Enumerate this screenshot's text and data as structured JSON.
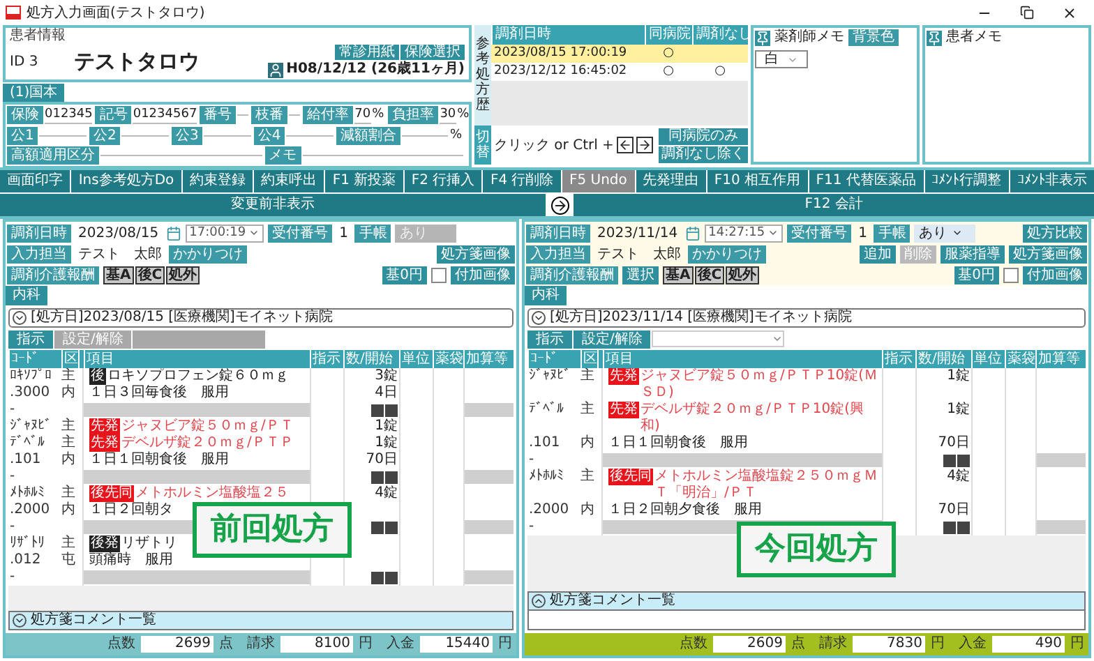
{
  "window": {
    "title": "処方入力画面(テストタロウ)"
  },
  "patient": {
    "section": "患者情報",
    "id": "ID 3",
    "name": "テストタロウ",
    "buttons": [
      "常診用紙",
      "保険選択"
    ],
    "birth": "H08/12/12 (26歳11ヶ月)"
  },
  "insurance": {
    "tab": "(1)国本",
    "rows": [
      [
        {
          "label": "保険",
          "value": "012345"
        },
        {
          "label": "記号",
          "value": "01234567"
        },
        {
          "label": "番号"
        },
        {
          "label": "枝番"
        },
        {
          "label": "給付率",
          "value": "70",
          "unit": "%"
        },
        {
          "label": "負担率",
          "value": "30",
          "unit": "%"
        }
      ],
      [
        {
          "label": "公1"
        },
        {
          "label": "公2"
        },
        {
          "label": "公3"
        },
        {
          "label": "公4"
        },
        {
          "label": "減額割合",
          "unit": "%"
        }
      ],
      [
        {
          "label": "高額適用区分"
        },
        {
          "label": "メモ"
        }
      ]
    ]
  },
  "history": {
    "label": "参考処方歴",
    "columns": [
      "調剤日時",
      "同病院",
      "調剤なし"
    ],
    "rows": [
      {
        "date": "2023/08/15 17:00:19",
        "same_hospital": "○",
        "selected": true
      },
      {
        "date": "2023/12/12 16:45:02",
        "same_hospital": "○",
        "no_dispense": "○",
        "selected": false
      }
    ],
    "switch_label": "切替",
    "hint": "クリック or Ctrl +",
    "buttons": [
      "同病院のみ",
      "調剤なし除く"
    ]
  },
  "memos": [
    {
      "title": "薬剤師メモ",
      "color_label": "背景色",
      "color_value": "白"
    },
    {
      "title": "患者メモ"
    }
  ],
  "toolbar": [
    {
      "kind": "button",
      "label": "画面印字",
      "disabled": false
    },
    {
      "kind": "button",
      "label": "Ins参考処方Do",
      "disabled": false
    },
    {
      "kind": "button",
      "label": "約束登録",
      "disabled": false
    },
    {
      "kind": "button",
      "label": "約束呼出",
      "disabled": false
    },
    {
      "kind": "button",
      "label": "F1 新投薬",
      "disabled": false
    },
    {
      "kind": "button",
      "label": "F2 行挿入",
      "disabled": false
    },
    {
      "kind": "button",
      "label": "F4 行削除",
      "disabled": false
    },
    {
      "kind": "button",
      "label": "F5 Undo",
      "disabled": true
    },
    {
      "kind": "button",
      "label": "先発理由",
      "disabled": false
    },
    {
      "kind": "button",
      "label": "F10 相互作用",
      "disabled": false
    },
    {
      "kind": "button",
      "label": "F11 代替医薬品",
      "disabled": false
    },
    {
      "kind": "button",
      "label": "ｺﾒﾝﾄ行調整",
      "disabled": false
    },
    {
      "kind": "button",
      "label": "ｺﾒﾝﾄ非表示",
      "disabled": false
    },
    {
      "kind": "button",
      "label": "変更前非表示",
      "disabled": false
    },
    {
      "kind": "arrow",
      "disabled": false
    },
    {
      "kind": "button",
      "label": "F12 会計",
      "disabled": false
    }
  ],
  "panels": [
    {
      "header": [
        {
          "left": [
            {
              "kind": "chip",
              "text": "調剤日時"
            },
            {
              "kind": "text",
              "text": "2023/08/15"
            },
            {
              "kind": "calendar"
            },
            {
              "kind": "time",
              "text": "17:00:19"
            },
            {
              "kind": "chip",
              "text": "受付番号"
            },
            {
              "kind": "text",
              "text": "1"
            },
            {
              "kind": "chip",
              "text": "手帳"
            },
            {
              "kind": "select",
              "text": "あり",
              "disabled": true
            }
          ]
        },
        {
          "left": [
            {
              "kind": "chip",
              "text": "入力担当"
            },
            {
              "kind": "text",
              "text": "テスト　太郎"
            },
            {
              "kind": "chip",
              "text": "かかりつけ"
            }
          ],
          "right": [
            {
              "kind": "button",
              "text": "処方箋画像",
              "disabled": false
            }
          ]
        },
        {
          "left": [
            {
              "kind": "chip",
              "text": "調剤介護報酬"
            },
            {
              "kind": "codes",
              "codes": [
                "基A",
                "後C",
                "処外"
              ]
            }
          ],
          "right": [
            {
              "kind": "button",
              "text": "基0円",
              "disabled": false
            },
            {
              "kind": "checkbox",
              "checked": false
            },
            {
              "kind": "button",
              "text": "付加画像",
              "disabled": false
            }
          ]
        }
      ],
      "tab": {
        "label": "内科",
        "selected": true
      },
      "rx_bar": {
        "label": "[処方日]2023/08/15 [医療機関]モイネット病院",
        "expanded": true
      },
      "instructions": {
        "buttons": [
          {
            "label": "指示",
            "disabled": false
          },
          {
            "label": "設定/解除",
            "disabled": true
          }
        ],
        "has_select": false
      },
      "columns": [
        "ｺｰﾄﾞ",
        "区",
        "項目",
        "指示",
        "数/開始",
        "単位",
        "薬袋",
        "加算等"
      ],
      "groups": [
        {
          "lines": [
            {
              "kind": "drug",
              "code": "ﾛｷｿﾌﾟﾛ",
              "kubun": "主",
              "badge": {
                "text": "後",
                "color": "#222222"
              },
              "item": "ロキソプロフェン錠６０ｍｇ",
              "brand": false,
              "qty": "3錠"
            },
            {
              "kind": "usage",
              "code": ".3000",
              "kubun": "内",
              "item": "１日３回毎食後　服用",
              "qty": "4日"
            },
            {
              "kind": "footer",
              "code": "-"
            }
          ]
        },
        {
          "lines": [
            {
              "kind": "drug",
              "code": "ｼﾞｬﾇﾋﾞ",
              "kubun": "主",
              "badge": {
                "text": "先発",
                "color": "#e8141b"
              },
              "item": "ジャヌビア錠５０ｍｇ/ＰＴ",
              "brand": true,
              "qty": "1錠"
            },
            {
              "kind": "drug",
              "code": "ﾃﾞﾍﾞﾙ",
              "kubun": "主",
              "badge": {
                "text": "先発",
                "color": "#e8141b"
              },
              "item": "デベルザ錠２０ｍｇ/ＰＴＰ",
              "brand": true,
              "qty": "1錠"
            },
            {
              "kind": "usage",
              "code": ".101",
              "kubun": "内",
              "item": "１日１回朝食後　服用",
              "qty": "70日"
            },
            {
              "kind": "footer",
              "code": "-"
            }
          ]
        },
        {
          "lines": [
            {
              "kind": "drug",
              "code": "ﾒﾄﾎﾙﾐ",
              "kubun": "主",
              "badge": {
                "text": "後先同",
                "color": "#e8141b"
              },
              "item": "メトホルミン塩酸塩２５",
              "brand": true,
              "qty": "4錠"
            },
            {
              "kind": "usage",
              "code": ".2000",
              "kubun": "内",
              "item": "１日２回朝タ"
            },
            {
              "kind": "footer",
              "code": "-"
            }
          ]
        },
        {
          "lines": [
            {
              "kind": "drug",
              "code": "ﾘｻﾞﾄﾘ",
              "kubun": "主",
              "badge": {
                "text": "後発",
                "color": "#222222"
              },
              "item": "リザトリ",
              "brand": false
            },
            {
              "kind": "usage",
              "code": ".012",
              "kubun": "屯",
              "item": "頭痛時　服用"
            },
            {
              "kind": "footer",
              "code": "-"
            }
          ]
        }
      ],
      "stamp": "前回処方",
      "comments": {
        "label": "処方箋コメント一覧",
        "expanded": false
      },
      "totals": {
        "color": "#7cc4c8",
        "items": [
          {
            "label": "点数",
            "value": "2699",
            "unit": "点"
          },
          {
            "label": "請求",
            "value": "8100",
            "unit": "円"
          },
          {
            "label": "入金",
            "value": "15440",
            "unit": "円"
          }
        ]
      }
    },
    {
      "header": [
        {
          "left": [
            {
              "kind": "chip",
              "text": "調剤日時"
            },
            {
              "kind": "text",
              "text": "2023/11/14"
            },
            {
              "kind": "calendar"
            },
            {
              "kind": "time",
              "text": "14:27:15"
            },
            {
              "kind": "chip",
              "text": "受付番号"
            },
            {
              "kind": "text",
              "text": "1"
            },
            {
              "kind": "chip",
              "text": "手帳"
            },
            {
              "kind": "select",
              "text": "あり",
              "disabled": false
            }
          ],
          "right": [
            {
              "kind": "button",
              "text": "処方比較",
              "disabled": false
            }
          ]
        },
        {
          "left": [
            {
              "kind": "chip",
              "text": "入力担当"
            },
            {
              "kind": "text",
              "text": "テスト　太郎"
            },
            {
              "kind": "chip",
              "text": "かかりつけ"
            }
          ],
          "right": [
            {
              "kind": "button",
              "text": "追加",
              "disabled": false
            },
            {
              "kind": "button",
              "text": "削除",
              "disabled": true
            },
            {
              "kind": "button",
              "text": "服薬指導",
              "disabled": false
            },
            {
              "kind": "button",
              "text": "処方箋画像",
              "disabled": false
            }
          ]
        },
        {
          "left": [
            {
              "kind": "chip",
              "text": "調剤介護報酬"
            },
            {
              "kind": "button",
              "text": "選択",
              "disabled": false
            },
            {
              "kind": "codes",
              "codes": [
                "基A",
                "後C",
                "処外"
              ]
            }
          ],
          "right": [
            {
              "kind": "button",
              "text": "基0円",
              "disabled": false
            },
            {
              "kind": "checkbox",
              "checked": false
            },
            {
              "kind": "button",
              "text": "付加画像",
              "disabled": false
            }
          ]
        }
      ],
      "tab": {
        "label": "内科",
        "selected": true
      },
      "rx_bar": {
        "label": "[処方日]2023/11/14 [医療機関]モイネット病院",
        "expanded": true
      },
      "instructions": {
        "buttons": [
          {
            "label": "指示",
            "disabled": false
          },
          {
            "label": "設定/解除",
            "disabled": false
          }
        ],
        "has_select": true
      },
      "columns": [
        "ｺｰﾄﾞ",
        "区",
        "項目",
        "指示",
        "数/開始",
        "単位",
        "薬袋",
        "加算等"
      ],
      "groups": [
        {
          "lines": [
            {
              "kind": "drug",
              "code": "ｼﾞｬﾇﾋﾞ",
              "kubun": "主",
              "badge": {
                "text": "先発",
                "color": "#e8141b"
              },
              "item": "ジャヌビア錠５０ｍｇ/ＰＴＰ10錠(ＭＳＤ)",
              "brand": true,
              "qty": "1錠"
            },
            {
              "kind": "drug",
              "code": "ﾃﾞﾍﾞﾙ",
              "kubun": "主",
              "badge": {
                "text": "先発",
                "color": "#e8141b"
              },
              "item": "デベルザ錠２０ｍｇ/ＰＴＰ10錠(興和)",
              "brand": true,
              "qty": "1錠"
            },
            {
              "kind": "usage",
              "code": ".101",
              "kubun": "内",
              "item": "１日１回朝食後　服用",
              "qty": "70日"
            },
            {
              "kind": "footer",
              "code": "-"
            }
          ]
        },
        {
          "lines": [
            {
              "kind": "drug",
              "code": "ﾒﾄﾎﾙﾐ",
              "kubun": "主",
              "badge": {
                "text": "後先同",
                "color": "#e8141b"
              },
              "item": "メトホルミン塩酸塩錠２５０ｍｇＭＴ「明治」/ＰＴ",
              "brand": true,
              "qty": "4錠"
            },
            {
              "kind": "usage",
              "code": ".2000",
              "kubun": "内",
              "item": "１日２回朝夕食後　服用",
              "qty": "70日"
            },
            {
              "kind": "footer",
              "code": "-"
            }
          ]
        }
      ],
      "stamp": "今回処方",
      "comments": {
        "label": "処方箋コメント一覧",
        "expanded": true
      },
      "totals": {
        "color": "#a3be1f",
        "items": [
          {
            "label": "点数",
            "value": "2609",
            "unit": "点"
          },
          {
            "label": "請求",
            "value": "7830",
            "unit": "円"
          },
          {
            "label": "入金",
            "value": "490",
            "unit": "円"
          }
        ]
      }
    }
  ]
}
